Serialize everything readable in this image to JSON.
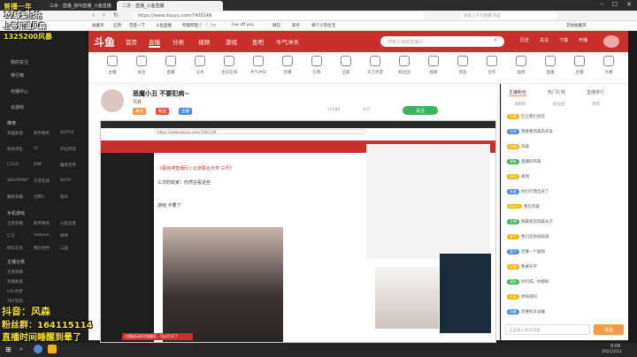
{
  "browser": {
    "tabs": [
      {
        "label": "三水 · 直播_我叫直播_斗鱼直播"
      },
      {
        "label": "二次 - 直播_斗鱼直播"
      }
    ],
    "url": "https://www.douyu.com/7400149",
    "search_placeholder": "搜索上千万直播 内容",
    "bookmarks": [
      "收藏夹",
      "应用",
      "百度一下",
      "斗鱼直播",
      "哔哩哔哩 (゜-゜)つ",
      "live off you",
      "微信",
      "知乎",
      "每个人的生活",
      "其他收藏夹"
    ]
  },
  "site": {
    "logo": "斗鱼",
    "nav": [
      "首页",
      "直播",
      "分类",
      "视频",
      "游戏",
      "鱼吧",
      "牛气冲天"
    ],
    "search_placeholder": "搜索主播或直播间",
    "header_icons": [
      "历史",
      "关注",
      "下载",
      "开播",
      "登录"
    ]
  },
  "sidebar": {
    "items": [
      "我的关注",
      "排行榜",
      "完播中心",
      "云游戏"
    ],
    "section_games": "推荐",
    "grid": [
      [
        "英雄联盟",
        "和平精英",
        "DOTA2"
      ],
      [
        "绝地求生",
        "CF",
        "炉石传说"
      ],
      [
        "CSGO",
        "DNF",
        "魔兽世界"
      ],
      [
        "VALORANT",
        "守望先锋",
        "DOTA"
      ],
      [
        "魔兽争霸",
        "剑网3",
        "鱼乐"
      ]
    ],
    "section_two": "手机游戏",
    "grid_two": [
      [
        "王者荣耀",
        "和平精英",
        "火影忍者"
      ],
      [
        "仁王",
        "Valheim",
        "原神"
      ],
      [
        "明日方舟",
        "我的世界",
        "三国"
      ]
    ],
    "section_three": "主播分类",
    "list_three": [
      "王者荣耀",
      "英雄联盟",
      "LOL手游",
      "TNT吃鸡",
      "天刀手游"
    ]
  },
  "categories": [
    "主播",
    "关注",
    "直播",
    "分享",
    "主页在线",
    "牛气冲天",
    "开播",
    "礼物",
    "全部",
    "天刀手游",
    "粉丝团",
    "视频",
    "贵族",
    "合作",
    "鱼吧",
    "直播",
    "主播",
    "大赛"
  ],
  "room": {
    "title": "恶魔小丑 不要犯病~",
    "streamer": "风森",
    "tags": [
      "关注",
      "粉丝",
      "主播"
    ],
    "follow_label": "关注",
    "viewers": "10580",
    "rank": "457"
  },
  "player": {
    "inner_url": "https://www.douyu.com/7400149",
    "inner_title": "《蔡徐坤直播间 | 北京联合大学 三尺》",
    "inner_label": "三次的玩家：仍然在看这些",
    "inner_tab": "游戏 不要了",
    "promo": "主播说玩家问我最近，可以打开了"
  },
  "chat": {
    "tabs": [
      "主播粉丝",
      "热门礼物",
      "直播排行"
    ],
    "subtabs": [
      "贡献榜",
      "粉丝团",
      "贵宾"
    ],
    "messages": [
      {
        "user": "风森",
        "text": "红尘我们也在",
        "color": "#f5b400"
      },
      {
        "user": "月光",
        "text": "我要看风森的天女",
        "color": "#4a8de0"
      },
      {
        "user": "风森",
        "text": "风森",
        "color": "#f5b400"
      },
      {
        "user": "萌新",
        "text": "直播的风森",
        "color": "#3bb35a"
      },
      {
        "user": "粉丝",
        "text": "谢谢",
        "color": "#f5b400"
      },
      {
        "user": "水友",
        "text": "你们打我出去了",
        "color": "#4a8de0"
      },
      {
        "user": "Harry",
        "text": "我在风森",
        "color": "#f5b400"
      },
      {
        "user": "主播",
        "text": "我最爱的风森女子",
        "color": "#3bb35a"
      },
      {
        "user": "老子",
        "text": "我们说你就知道",
        "color": "#f5b400"
      },
      {
        "user": "蓝子",
        "text": "老婆一个猛唱",
        "color": "#4a8de0"
      },
      {
        "user": "风森",
        "text": "我要天宇",
        "color": "#f5b400"
      },
      {
        "user": "萌新",
        "text": "你们说，你都知",
        "color": "#3bb35a"
      },
      {
        "user": "水友",
        "text": "你知道吗",
        "color": "#f5b400"
      },
      {
        "user": "风森",
        "text": "老婆别太早睡",
        "color": "#4a8de0"
      }
    ],
    "input_placeholder": "这里输入聊天内容",
    "send_label": "发送"
  },
  "overlay": {
    "top_left_1": "普播一年",
    "top_left_2": "12级爱上铭",
    "top_left_3": "上帝知道风森",
    "top_left_4": "1325200风暴",
    "bottom_1": "抖音：风森",
    "bottom_2": "粉丝群：164115114",
    "bottom_3": "直播时间睡醒到晕了"
  },
  "taskbar": {
    "time": "0:09",
    "date": "2021/2/11"
  },
  "colors": {
    "brand": "#c9302c",
    "overlay_yellow": "#f7e71a",
    "sidebar": "#1e1e1e"
  }
}
